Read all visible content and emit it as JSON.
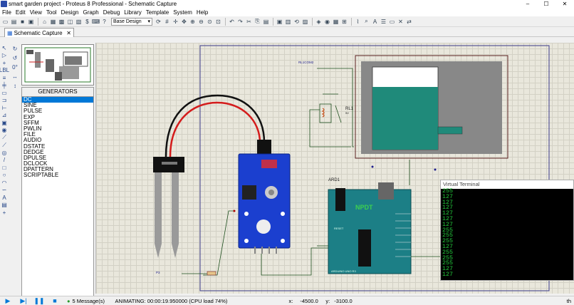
{
  "window": {
    "title": "smart garden project - Proteus 8 Professional - Schematic Capture",
    "min": "–",
    "max": "☐",
    "close": "✕"
  },
  "menu": [
    "File",
    "Edit",
    "View",
    "Tool",
    "Design",
    "Graph",
    "Debug",
    "Library",
    "Template",
    "System",
    "Help"
  ],
  "toolbar": {
    "design_select": "Base Design"
  },
  "tabs": [
    {
      "label": "Schematic Capture"
    }
  ],
  "generators": {
    "header": "GENERATORS",
    "items": [
      "DC",
      "SINE",
      "PULSE",
      "EXP",
      "SFFM",
      "PWLIN",
      "FILE",
      "AUDIO",
      "DSTATE",
      "DEDGE",
      "DPULSE",
      "DCLOCK",
      "DPATTERN",
      "SCRIPTABLE"
    ],
    "selected": 0
  },
  "left_label": "0°",
  "schematic": {
    "sensor_label": "",
    "relay_label": "RL1",
    "relay_sub": "5V",
    "arduino_label": "ARD1",
    "arduino_brand": "NPDT",
    "arduino_caption": "ARDUINO UNO R3",
    "reset": "RESET",
    "small_label_top": "RL1COM2",
    "small_label_bottom": "P3"
  },
  "virtual_terminal": {
    "title": "Virtual Terminal",
    "lines": [
      "255",
      "127",
      "127",
      "127",
      "127",
      "127",
      "127",
      "255",
      "255",
      "255",
      "127",
      "255",
      "255",
      "255",
      "127",
      "127"
    ]
  },
  "status": {
    "messages": "5 Message(s)",
    "animating": "ANIMATING: 00:00:19.950000 (CPU load 74%)",
    "x_label": "x:",
    "x_value": "-4500.0",
    "y_label": "y:",
    "y_value": "-3100.0",
    "th": "th"
  },
  "colors": {
    "water": "#1f8a7a",
    "sensor_board": "#1b3fcf",
    "arduino": "#1c7f86",
    "terminal_text": "#23c83b"
  }
}
